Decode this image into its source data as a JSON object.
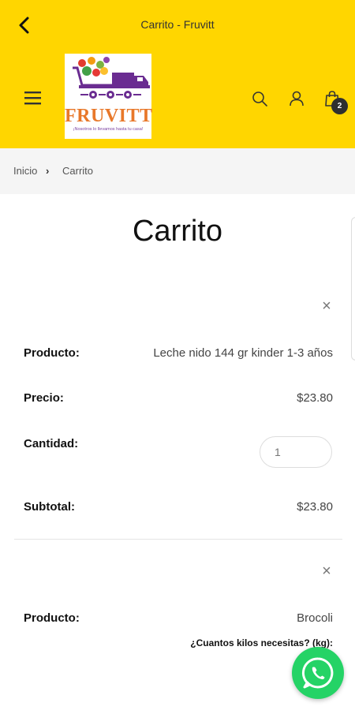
{
  "appbar": {
    "title": "Carrito - Fruvitt"
  },
  "header": {
    "logo_text": "FRUVITT",
    "logo_tagline": "¡Nosotros lo llevamos hasta tu casa!",
    "cart_count": "2",
    "accent_color": "#FFD600"
  },
  "breadcrumb": {
    "home": "Inicio",
    "separator": "›",
    "current": "Carrito"
  },
  "page": {
    "title": "Carrito"
  },
  "items": [
    {
      "remove": "×",
      "product_label": "Producto:",
      "product": "Leche nido 144 gr kinder 1-3 años",
      "price_label": "Precio:",
      "price": "$23.80",
      "quantity_label": "Cantidad:",
      "quantity_placeholder": "1",
      "subtotal_label": "Subtotal:",
      "subtotal": "$23.80"
    },
    {
      "remove": "×",
      "product_label": "Producto:",
      "product": "Brocoli",
      "kilos_label": "¿Cuantos kilos necesitas? (kg):"
    }
  ],
  "whatsapp": {
    "icon": "whatsapp-icon",
    "color": "#25D366"
  }
}
